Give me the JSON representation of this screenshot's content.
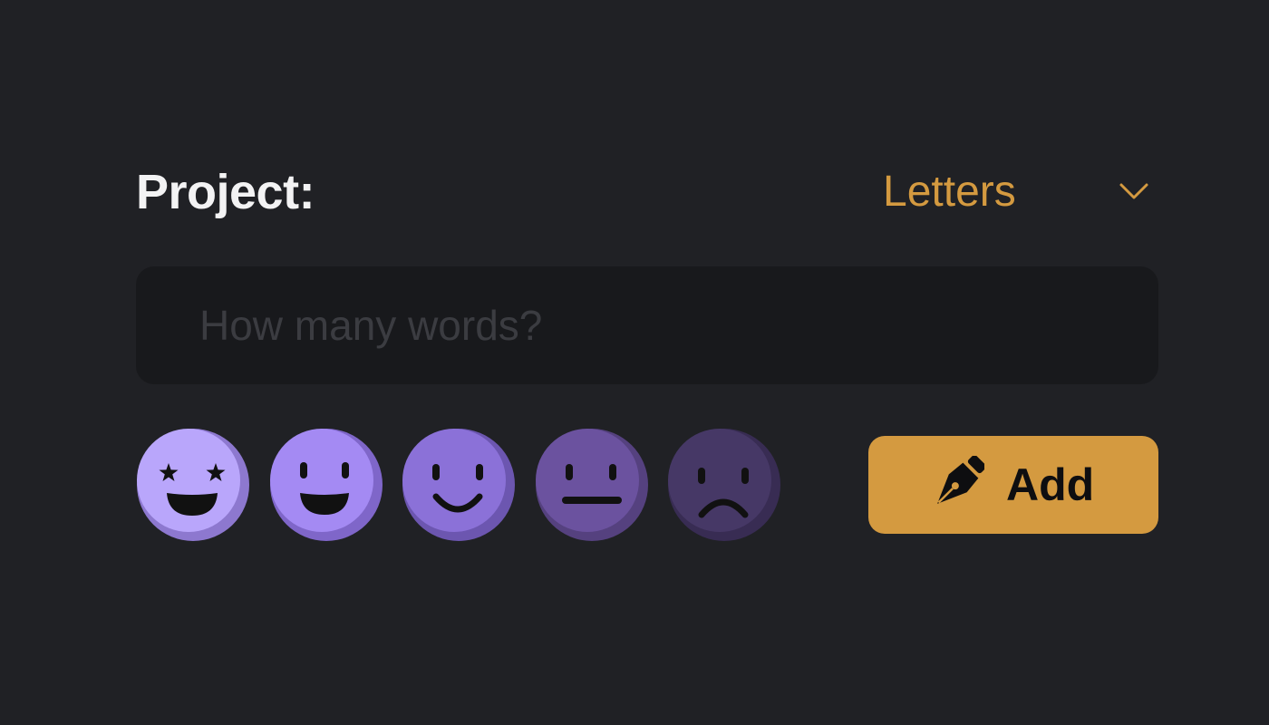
{
  "project": {
    "label": "Project:",
    "selected": "Letters"
  },
  "words_input": {
    "placeholder": "How many words?",
    "value": ""
  },
  "moods": [
    {
      "name": "star-struck-face-icon",
      "color": "#b9a6fb",
      "shade": "#8d78cf"
    },
    {
      "name": "happy-face-icon",
      "color": "#a48af3",
      "shade": "#7f66c9"
    },
    {
      "name": "smiling-face-icon",
      "color": "#8b71d8",
      "shade": "#6c56b0"
    },
    {
      "name": "neutral-face-icon",
      "color": "#6b529f",
      "shade": "#55417f"
    },
    {
      "name": "sad-face-icon",
      "color": "#463866",
      "shade": "#382c53"
    }
  ],
  "add_button": {
    "label": "Add",
    "icon": "pen-nib-icon"
  },
  "colors": {
    "background": "#202125",
    "input_background": "#18191c",
    "accent": "#d49a40"
  }
}
